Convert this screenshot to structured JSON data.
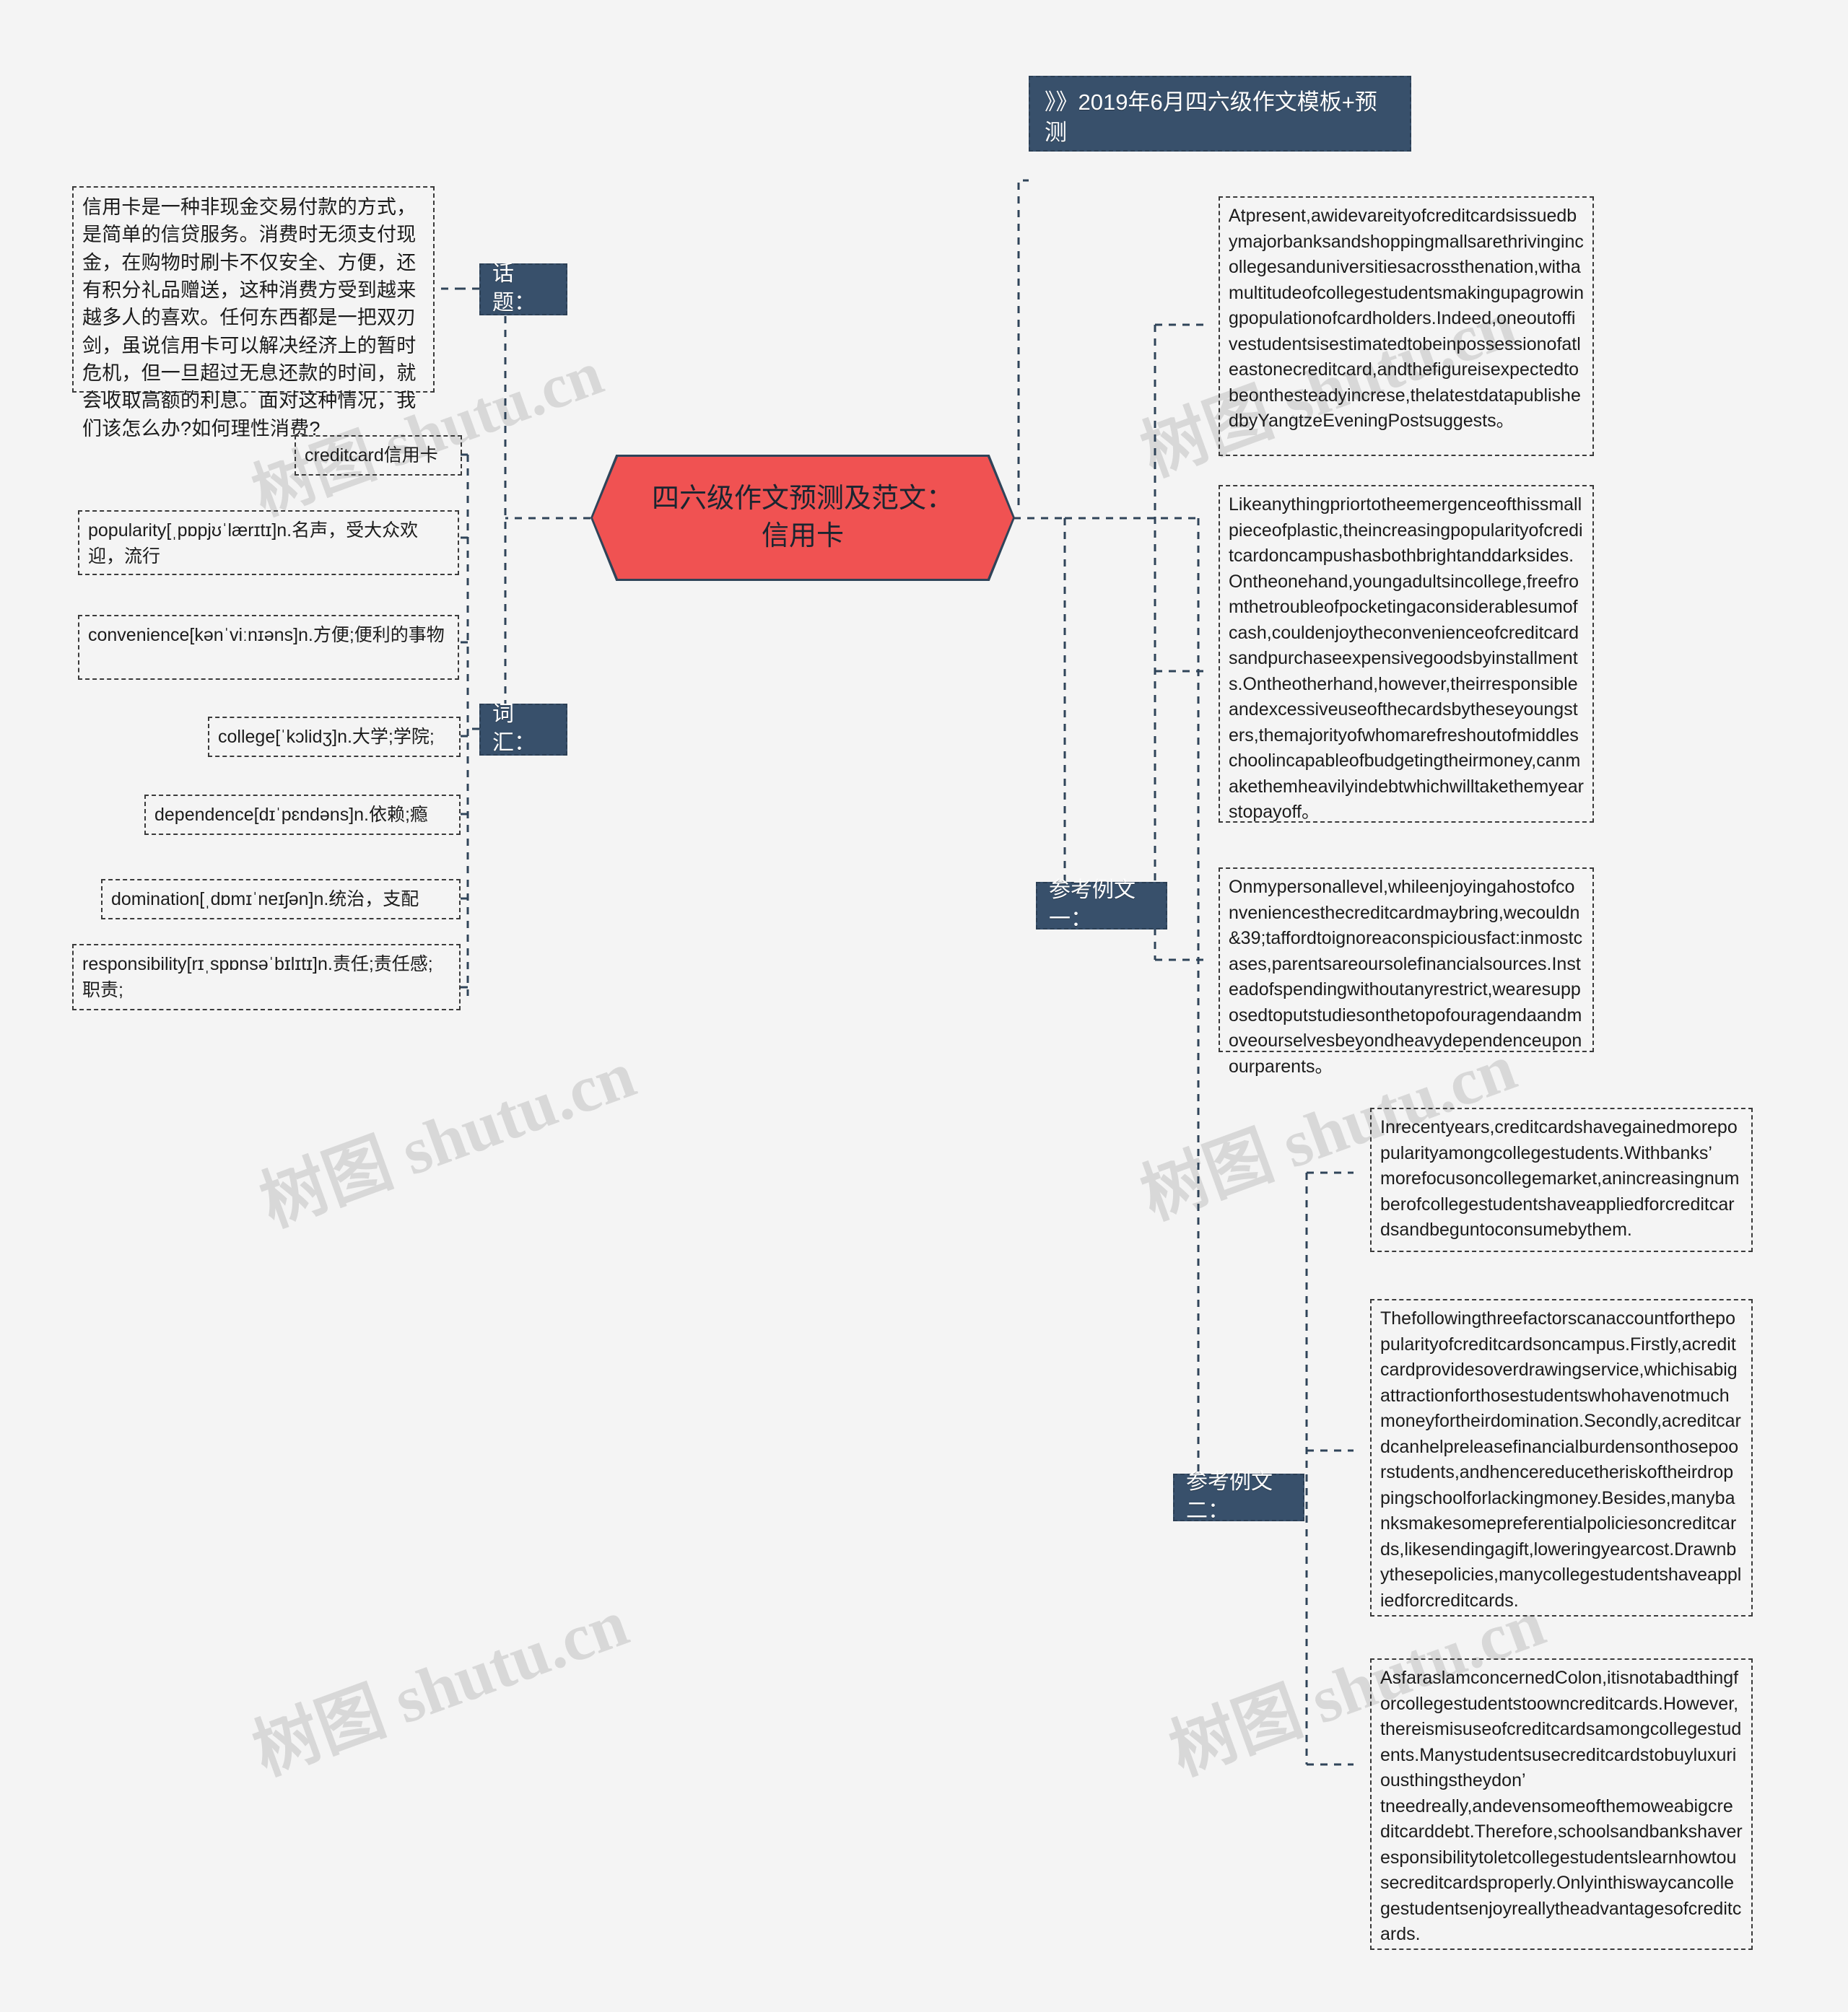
{
  "page": {
    "background": "#f4f4f4",
    "accent_red": "#f05252",
    "accent_dark": "#38506b",
    "watermark_text_cn": "树图 shutu.cn"
  },
  "title_node": {
    "label": "》》2019年6月四六级作文模板+预测"
  },
  "center_node": {
    "label": "四六级作文预测及范文：\n信用卡"
  },
  "branch_labels": {
    "topic": "话题：",
    "vocabulary": "词汇：",
    "sample_one": "参考例文一：",
    "sample_two": "参考例文二："
  },
  "topic_text": "信用卡是一种非现金交易付款的方式，是简单的信贷服务。消费时无须支付现金，在购物时刷卡不仅安全、方便，还有积分礼品赠送，这种消费方受到越来越多人的喜欢。任何东西都是一把双刃剑，虽说信用卡可以解决经济上的暂时危机，但一旦超过无息还款的时间，就会收取高额的利息。面对这种情况，我们该怎么办?如何理性消费?",
  "vocabulary": [
    {
      "text": "creditcard信用卡"
    },
    {
      "text": "popularity[ˌpɒpjʊˈlærɪtɪ]n.名声，受大众欢迎，流行"
    },
    {
      "text": "convenience[kənˈviːnɪəns]n.方便;便利的事物"
    },
    {
      "text": "college[ˈkɔlidʒ]n.大学;学院;"
    },
    {
      "text": "dependence[dɪˈpɛndəns]n.依赖;瘾"
    },
    {
      "text": "domination[ˌdɒmɪˈneɪʃən]n.统治，支配"
    },
    {
      "text": "responsibility[rɪˌspɒnsəˈbɪlɪtɪ]n.责任;责任感;职责;"
    }
  ],
  "sample_one_paragraphs": [
    {
      "text": "Atpresent,awidevareityofcreditcardsissuedbymajorbanksandshoppingmallsarethrivingincollegesanduniversitiesacrossthenation,withamultitudeofcollegestudentsmakingupagrowingpopulationofcardholders.Indeed,oneoutoffivestudentsisestimatedtobeinpossessionofatleastonecreditcard,andthefigureisexpectedtobeonthesteadyincrese,thelatestdatapublishedbyYangtzeEveningPostsuggests。"
    },
    {
      "text": "Likeanythingpriortotheemergenceofthissmallpieceofplastic,theincreasingpopularityofcreditcardoncampushasbothbrightanddarksides.Ontheonehand,youngadultsincollege,freefromthetroubleofpocketingaconsiderablesumofcash,couldenjoytheconvenienceofcreditcardsandpurchaseexpensivegoodsbyinstallments.Ontheotherhand,however,theirresponsibleandexcessiveuseofthecardsbytheseyoungsters,themajorityofwhomarefreshoutofmiddleschoolincapableofbudgetingtheirmoney,canmakethemheavilyindebtwhichwilltakethemyearstopayoff。"
    },
    {
      "text": "Onmypersonallevel,whileenjoyingahostofconveniencesthecreditcardmaybring,wecouldn&39;taffordtoignoreaconspiciousfact:inmostcases,parentsareoursolefinancialsources.Insteadofspendingwithoutanyrestrict,wearesupposedtoputstudiesonthetopofouragendaandmoveourselvesbeyondheavydependenceuponourparents。"
    }
  ],
  "sample_two_paragraphs": [
    {
      "text": "Inrecentyears,creditcardshavegainedmorepopularityamongcollegestudents.Withbanks’ morefocusoncollegemarket,anincreasingnumberofcollegestudentshaveappliedforcreditcardsandbeguntoconsumebythem."
    },
    {
      "text": "Thefollowingthreefactorscanaccountforthepopularityofcreditcardsoncampus.Firstly,acreditcardprovidesoverdrawingservice,whichisabigattractionforthosestudentswhohavenotmuchmoneyfortheirdomination.Secondly,acreditcardcanhelpreleasefinancialburdensonthosepoorstudents,andhencereducetheriskoftheirdroppingschoolforlackingmoney.Besides,manybanksmakesomepreferentialpoliciesoncreditcards,likesendingagift,loweringyearcost.Drawnbythesepolicies,manycollegestudentshaveappliedforcreditcards."
    },
    {
      "text": "AsfaraslamconcernedColon,itisnotabadthingforcollegestudentstoowncreditcards.However,thereismisuseofcreditcardsamongcollegestudents.Manystudentsusecreditcardstobuyluxuriousthingstheydon’ tneedreally,andevensomeofthemoweabigcreditcarddebt.Therefore,schoolsandbankshaveresponsibilitytoletcollegestudentslearnhowtousecreditcardsproperly.Onlyinthiswaycancollegestudentsenjoyreallytheadvantagesofcreditcards."
    }
  ]
}
